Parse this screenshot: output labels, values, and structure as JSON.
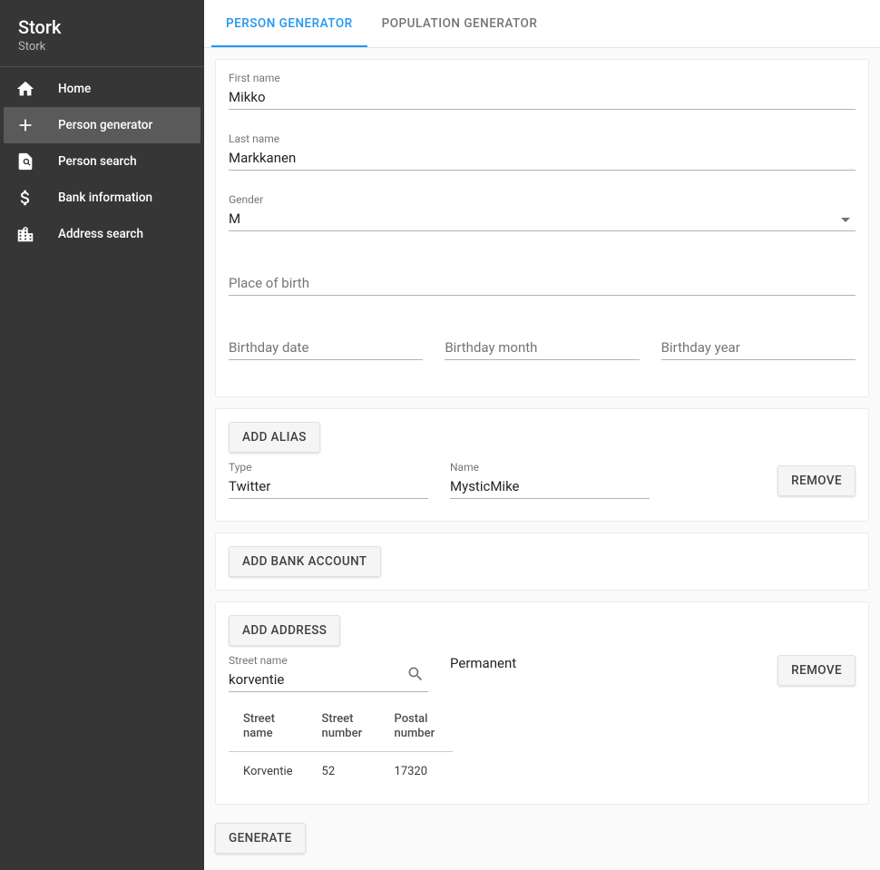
{
  "app": {
    "title": "Stork",
    "subtitle": "Stork"
  },
  "sidebar": {
    "items": [
      {
        "label": "Home",
        "icon": "home"
      },
      {
        "label": "Person generator",
        "icon": "plus",
        "active": true
      },
      {
        "label": "Person search",
        "icon": "person-search"
      },
      {
        "label": "Bank information",
        "icon": "dollar"
      },
      {
        "label": "Address search",
        "icon": "building"
      }
    ]
  },
  "tabs": [
    {
      "label": "Person Generator",
      "active": true
    },
    {
      "label": "Population Generator",
      "active": false
    }
  ],
  "person": {
    "first_name_label": "First name",
    "first_name": "Mikko",
    "last_name_label": "Last name",
    "last_name": "Markkanen",
    "gender_label": "Gender",
    "gender": "M",
    "place_of_birth_placeholder": "Place of birth",
    "place_of_birth": "",
    "birthday_date_placeholder": "Birthday date",
    "birthday_date": "",
    "birthday_month_placeholder": "Birthday month",
    "birthday_month": "",
    "birthday_year_placeholder": "Birthday year",
    "birthday_year": ""
  },
  "alias": {
    "add_button": "Add alias",
    "type_label": "Type",
    "type": "Twitter",
    "name_label": "Name",
    "name": "MysticMike",
    "remove_button": "Remove"
  },
  "bank": {
    "add_button": "Add bank account"
  },
  "address": {
    "add_button": "Add address",
    "street_name_label": "Street name",
    "street_name_value": "korventie",
    "permanent_label": "Permanent",
    "remove_button": "Remove",
    "table": {
      "headers": {
        "street": "Street name",
        "number": "Street number",
        "postal": "Postal number"
      },
      "row": {
        "street": "Korventie",
        "number": "52",
        "postal": "17320"
      }
    }
  },
  "generate_button": "Generate"
}
